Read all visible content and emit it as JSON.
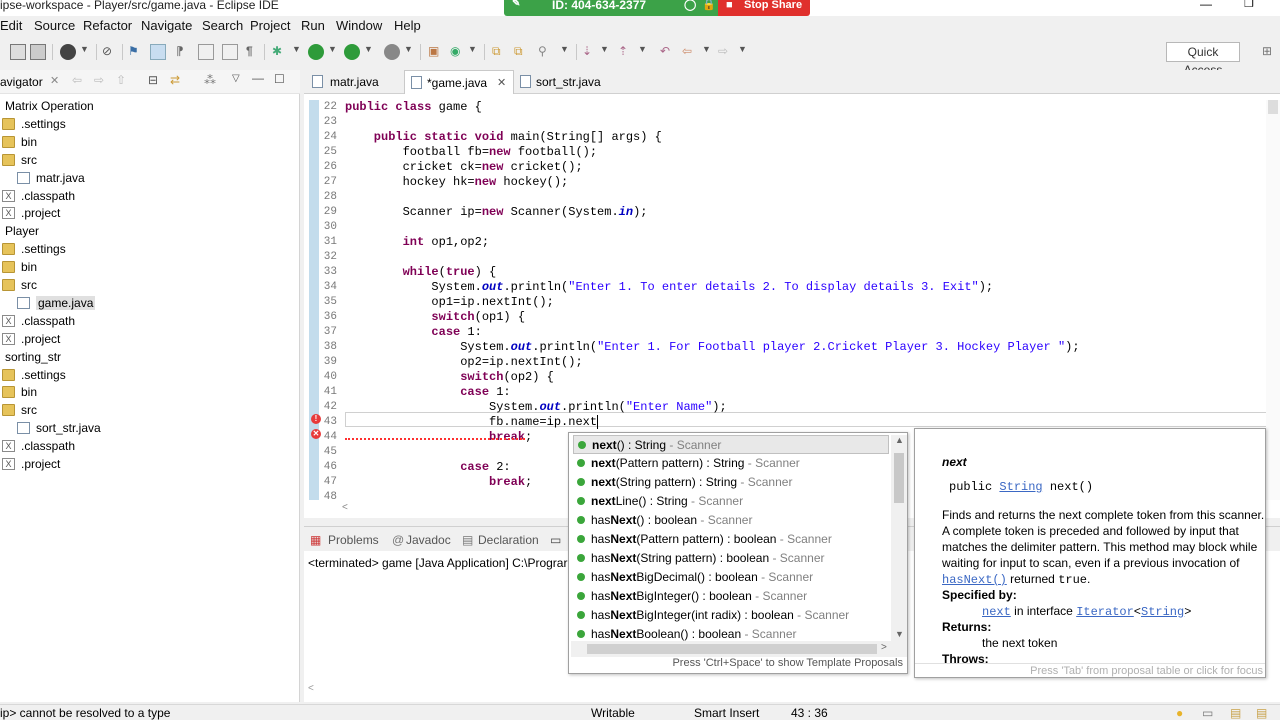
{
  "window": {
    "title": "ipse-workspace - Player/src/game.java - Eclipse IDE",
    "share_id": "ID: 404-634-2377",
    "stop_share": "Stop Share"
  },
  "menu": [
    "Edit",
    "Source",
    "Refactor",
    "Navigate",
    "Search",
    "Project",
    "Run",
    "Window",
    "Help"
  ],
  "toolbar": {
    "quick_access": "Quick Access"
  },
  "navigator": {
    "title": "avigator",
    "items": [
      {
        "label": "Matrix Operation",
        "kind": "project"
      },
      {
        "label": ".settings",
        "kind": "folder"
      },
      {
        "label": "bin",
        "kind": "folder"
      },
      {
        "label": "src",
        "kind": "folder"
      },
      {
        "label": "matr.java",
        "kind": "java"
      },
      {
        "label": ".classpath",
        "kind": "xml"
      },
      {
        "label": ".project",
        "kind": "xml"
      },
      {
        "label": "Player",
        "kind": "project"
      },
      {
        "label": ".settings",
        "kind": "folder"
      },
      {
        "label": "bin",
        "kind": "folder"
      },
      {
        "label": "src",
        "kind": "folder"
      },
      {
        "label": "game.java",
        "kind": "java"
      },
      {
        "label": ".classpath",
        "kind": "xml"
      },
      {
        "label": ".project",
        "kind": "xml"
      },
      {
        "label": "sorting_str",
        "kind": "project"
      },
      {
        "label": ".settings",
        "kind": "folder"
      },
      {
        "label": "bin",
        "kind": "folder"
      },
      {
        "label": "src",
        "kind": "folder"
      },
      {
        "label": "sort_str.java",
        "kind": "java"
      },
      {
        "label": ".classpath",
        "kind": "xml"
      },
      {
        "label": ".project",
        "kind": "xml"
      }
    ]
  },
  "editor": {
    "tabs": [
      {
        "label": "matr.java"
      },
      {
        "label": "*game.java"
      },
      {
        "label": "sort_str.java"
      }
    ],
    "line_numbers": [
      "22",
      "23",
      "24",
      "25",
      "26",
      "27",
      "28",
      "29",
      "30",
      "31",
      "32",
      "33",
      "34",
      "35",
      "36",
      "37",
      "38",
      "39",
      "40",
      "41",
      "42",
      "43",
      "44",
      "45",
      "46",
      "47",
      "48"
    ],
    "code": {
      "l22a": "public class",
      "l22b": " game {",
      "l24a": "    public static void",
      "l24b": " main(String[] args) {",
      "l25": "        football fb=",
      "l25k": "new",
      "l25b": " football();",
      "l26": "        cricket ck=",
      "l26k": "new",
      "l26b": " cricket();",
      "l27": "        hockey hk=",
      "l27k": "new",
      "l27b": " hockey();",
      "l29": "        Scanner ip=",
      "l29k": "new",
      "l29b": " Scanner(System.",
      "l29f": "in",
      "l29c": ");",
      "l31k": "        int",
      "l31b": " op1,op2;",
      "l33k": "        while",
      "l33b": "(",
      "l33k2": "true",
      "l33c": ") {",
      "l34a": "            System.",
      "l34f": "out",
      "l34b": ".println(",
      "l34s": "\"Enter 1. To enter details 2. To display details 3. Exit\"",
      "l34c": ");",
      "l35": "            op1=ip.nextInt();",
      "l36k": "            switch",
      "l36b": "(op1) {",
      "l37k": "            case",
      "l37b": " 1:",
      "l38a": "                System.",
      "l38f": "out",
      "l38b": ".println(",
      "l38s": "\"Enter 1. For Football player 2.Cricket Player 3. Hockey Player \"",
      "l38c": ");",
      "l39": "                op2=ip.nextInt();",
      "l40k": "                switch",
      "l40b": "(op2) {",
      "l41k": "                case",
      "l41b": " 1:",
      "l42a": "                    System.",
      "l42f": "out",
      "l42b": ".println(",
      "l42s": "\"Enter Name\"",
      "l42c": ");",
      "l43": "                    fb.name=ip.next",
      "l44k": "                    break",
      "l44b": ";",
      "l46k": "                case",
      "l46b": " 2:",
      "l47k": "                    break",
      "l47b": ";"
    }
  },
  "bottom_panel": {
    "tabs": [
      "Problems",
      "Javadoc",
      "Declaration"
    ],
    "console": "<terminated> game [Java Application] C:\\Prograr"
  },
  "completion": {
    "items": [
      {
        "bold": "next",
        "rest": "() : String",
        "type": " - Scanner"
      },
      {
        "bold": "next",
        "rest": "(Pattern pattern) : String",
        "type": " - Scanner"
      },
      {
        "bold": "next",
        "rest": "(String pattern) : String",
        "type": " - Scanner"
      },
      {
        "bold": "next",
        "rest": "Line() : String",
        "type": " - Scanner"
      },
      {
        "pre": "has",
        "bold": "Next",
        "rest": "() : boolean",
        "type": " - Scanner"
      },
      {
        "pre": "has",
        "bold": "Next",
        "rest": "(Pattern pattern) : boolean",
        "type": " - Scanner"
      },
      {
        "pre": "has",
        "bold": "Next",
        "rest": "(String pattern) : boolean",
        "type": " - Scanner"
      },
      {
        "pre": "has",
        "bold": "Next",
        "rest": "BigDecimal() : boolean",
        "type": " - Scanner"
      },
      {
        "pre": "has",
        "bold": "Next",
        "rest": "BigInteger() : boolean",
        "type": " - Scanner"
      },
      {
        "pre": "has",
        "bold": "Next",
        "rest": "BigInteger(int radix) : boolean",
        "type": " - Scanner"
      },
      {
        "pre": "has",
        "bold": "Next",
        "rest": "Boolean() : boolean",
        "type": " - Scanner"
      }
    ],
    "footer": "Press 'Ctrl+Space' to show Template Proposals"
  },
  "javadoc": {
    "name": "next",
    "sig_a": "public ",
    "sig_link": "String",
    "sig_b": " next()",
    "desc1": "Finds and returns the next complete token from this scanner.",
    "desc2": "A complete token is preceded and followed by input that",
    "desc3": "matches the delimiter pattern. This method may block while",
    "desc4": "waiting for input to scan, even if a previous invocation of",
    "desc5_link": "hasNext()",
    "desc5_b": " returned ",
    "desc5_c": "true",
    "desc5_d": ".",
    "specified_by": "Specified by:",
    "spec_link": "next",
    "spec_b": " in interface ",
    "spec_iface": "Iterator",
    "spec_lt": "<",
    "spec_str": "String",
    "spec_gt": ">",
    "returns": "Returns:",
    "returns_val": "the next token",
    "throws": "Throws:",
    "footer": "Press 'Tab' from proposal table or click for focus"
  },
  "statusbar": {
    "error": "ip> cannot be resolved to a type",
    "writable": "Writable",
    "insert": "Smart Insert",
    "position": "43 : 36"
  },
  "colors": {
    "share_green": "#3ca248",
    "share_red": "#e0302c",
    "keyword": "#7f0055",
    "string": "#2a00ff",
    "field": "#0000c0"
  }
}
